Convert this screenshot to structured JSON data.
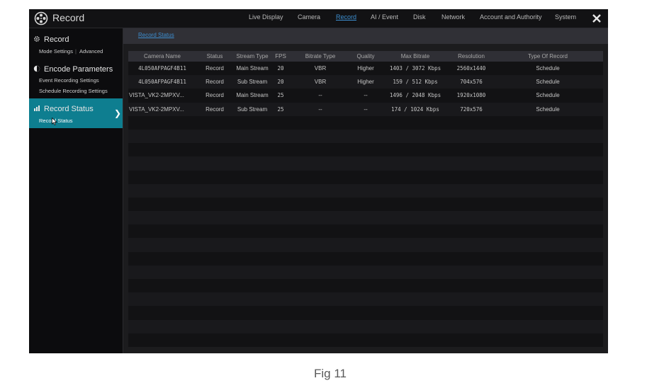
{
  "app": {
    "title": "Record"
  },
  "nav": [
    "Live Display",
    "Camera",
    "Record",
    "AI / Event",
    "Disk",
    "Network",
    "Account and Authority",
    "System"
  ],
  "sidebar": {
    "record": {
      "label": "Record",
      "subs": [
        "Mode Settings",
        "Advanced"
      ]
    },
    "encode": {
      "label": "Encode Parameters",
      "subs": [
        "Event Recording Settings",
        "Schedule Recording Settings"
      ]
    },
    "status": {
      "label": "Record Status",
      "subs": [
        "Record Status"
      ]
    }
  },
  "subtab": "Record Status",
  "table": {
    "headers": [
      "Camera Name",
      "Status",
      "Stream Type",
      "FPS",
      "Bitrate Type",
      "Quality",
      "Max Bitrate",
      "Resolution",
      "Type Of Record"
    ],
    "rows": [
      [
        "4L050AFPAGF4B11",
        "Record",
        "Main Stream",
        "20",
        "VBR",
        "Higher",
        "1403 / 3072 Kbps",
        "2560x1440",
        "Schedule"
      ],
      [
        "4L050AFPAGF4B11",
        "Record",
        "Sub Stream",
        "20",
        "VBR",
        "Higher",
        "159 / 512 Kbps",
        "704x576",
        "Schedule"
      ],
      [
        "VISTA_VK2-2MPXV...",
        "Record",
        "Main Stream",
        "25",
        "--",
        "--",
        "1496 / 2048 Kbps",
        "1920x1080",
        "Schedule"
      ],
      [
        "VISTA_VK2-2MPXV...",
        "Record",
        "Sub Stream",
        "25",
        "--",
        "--",
        "174 / 1024 Kbps",
        "720x576",
        "Schedule"
      ]
    ]
  },
  "caption": "Fig 11",
  "colors": {
    "accent": "#0e7e90",
    "link": "#3d8fd1",
    "background": "#0b0b0d"
  }
}
